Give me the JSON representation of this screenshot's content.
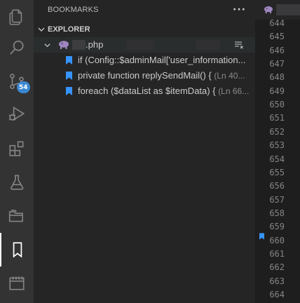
{
  "activity_bar": {
    "items": [
      {
        "name": "explorer-icon"
      },
      {
        "name": "search-icon"
      },
      {
        "name": "source-control-icon"
      },
      {
        "name": "run-debug-icon"
      },
      {
        "name": "extensions-icon"
      },
      {
        "name": "testing-icon"
      },
      {
        "name": "project-manager-icon"
      },
      {
        "name": "bookmarks-icon"
      },
      {
        "name": "calendar-icon"
      }
    ],
    "source_control_badge": "54",
    "active_item": "bookmarks-icon"
  },
  "sidebar": {
    "title": "BOOKMARKS",
    "more_actions": "···",
    "section": {
      "title": "EXPLORER",
      "file": {
        "name": ".php",
        "bookmarks": [
          {
            "text": "if (Config::$adminMail['user_information...",
            "location": ""
          },
          {
            "text": "private function replySendMail() {",
            "location": "(Ln 40..."
          },
          {
            "text": "foreach ($dataList as $itemData) {",
            "location": "(Ln 66..."
          }
        ]
      }
    }
  },
  "editor": {
    "line_numbers": [
      "644",
      "645",
      "646",
      "647",
      "648",
      "649",
      "650",
      "651",
      "652",
      "653",
      "654",
      "655",
      "656",
      "657",
      "658",
      "659",
      "660",
      "661",
      "662",
      "663",
      "664"
    ],
    "bookmarked_line": "660"
  },
  "colors": {
    "accent_blue": "#3c88d2",
    "bookmark_blue": "#3794ff",
    "php_purple": "#8892bf"
  }
}
